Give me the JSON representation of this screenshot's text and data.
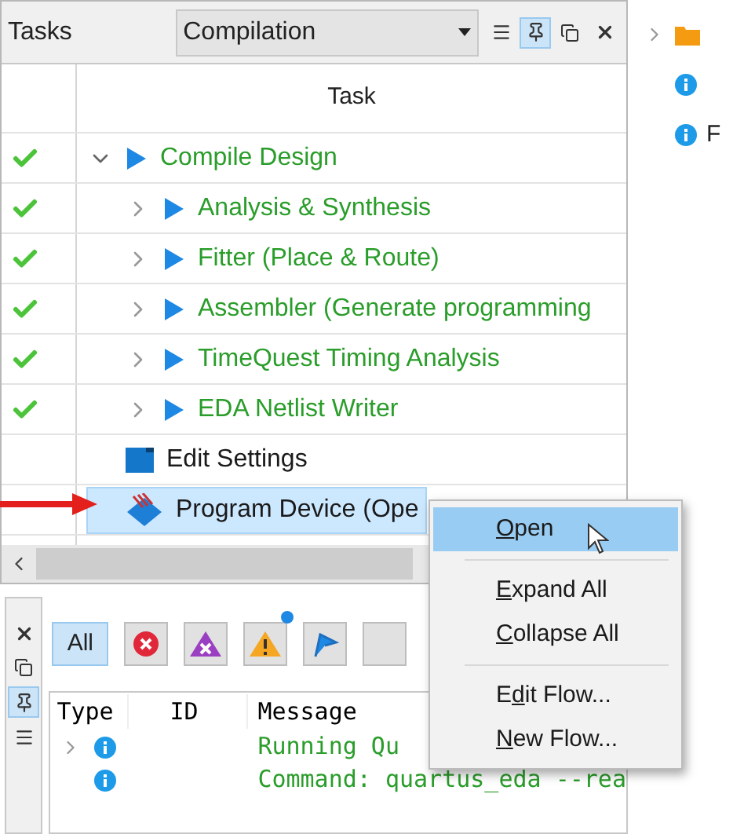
{
  "panel": {
    "title": "Tasks",
    "flow": "Compilation",
    "tools": [
      {
        "kind": "menu",
        "selected": false
      },
      {
        "kind": "pin",
        "selected": true
      },
      {
        "kind": "float",
        "selected": false
      },
      {
        "kind": "close",
        "selected": false
      }
    ]
  },
  "table": {
    "columns": [
      "Task"
    ],
    "rows": [
      {
        "label": "Compile Design",
        "kind": "flow",
        "done": true,
        "expanded": true,
        "selected": false,
        "children": [
          {
            "label": "Analysis & Synthesis",
            "kind": "flow",
            "done": true,
            "expanded": false,
            "selected": false
          },
          {
            "label": "Fitter (Place & Route)",
            "kind": "flow",
            "done": true,
            "expanded": false,
            "selected": false
          },
          {
            "label": "Assembler (Generate programming",
            "kind": "flow",
            "done": true,
            "expanded": false,
            "selected": false
          },
          {
            "label": "TimeQuest Timing Analysis",
            "kind": "flow",
            "done": true,
            "expanded": false,
            "selected": false
          },
          {
            "label": "EDA Netlist Writer",
            "kind": "flow",
            "done": true,
            "expanded": false,
            "selected": false
          }
        ]
      },
      {
        "label": "Edit Settings",
        "kind": "settings",
        "done": false,
        "selected": false
      },
      {
        "label": "Program Device (Ope",
        "kind": "program",
        "done": false,
        "selected": true
      }
    ]
  },
  "context_menu": {
    "groups": [
      [
        {
          "key": "O",
          "rest": "pen",
          "selected": true
        }
      ],
      [
        {
          "key": "E",
          "rest": "xpand All",
          "selected": false
        },
        {
          "key": "C",
          "rest": "ollapse All",
          "selected": false
        }
      ],
      [
        {
          "before": "E",
          "key": "d",
          "rest": "it Flow...",
          "selected": false
        },
        {
          "key": "N",
          "rest": "ew Flow...",
          "selected": false
        }
      ]
    ]
  },
  "messages": {
    "tools": [
      {
        "kind": "close",
        "selected": false
      },
      {
        "kind": "float",
        "selected": false
      },
      {
        "kind": "pin",
        "selected": true
      },
      {
        "kind": "menu",
        "selected": false
      }
    ],
    "filters": [
      {
        "kind": "all",
        "label": "All",
        "selected": true
      },
      {
        "kind": "error",
        "selected": false
      },
      {
        "kind": "critical",
        "selected": false
      },
      {
        "kind": "warning",
        "selected": false,
        "badge": true
      },
      {
        "kind": "flag",
        "selected": false
      },
      {
        "kind": "blank",
        "selected": false
      }
    ],
    "columns": [
      "Type",
      "ID",
      "Message"
    ],
    "rows": [
      {
        "kind": "info",
        "expandable": true,
        "message": "Running Qu"
      },
      {
        "kind": "info",
        "expandable": false,
        "message": "Command: quartus_eda --rea"
      }
    ]
  },
  "side_tree": [
    {
      "kind": "folder",
      "expanded": false
    },
    {
      "kind": "info"
    },
    {
      "kind": "info",
      "label": "F"
    }
  ]
}
